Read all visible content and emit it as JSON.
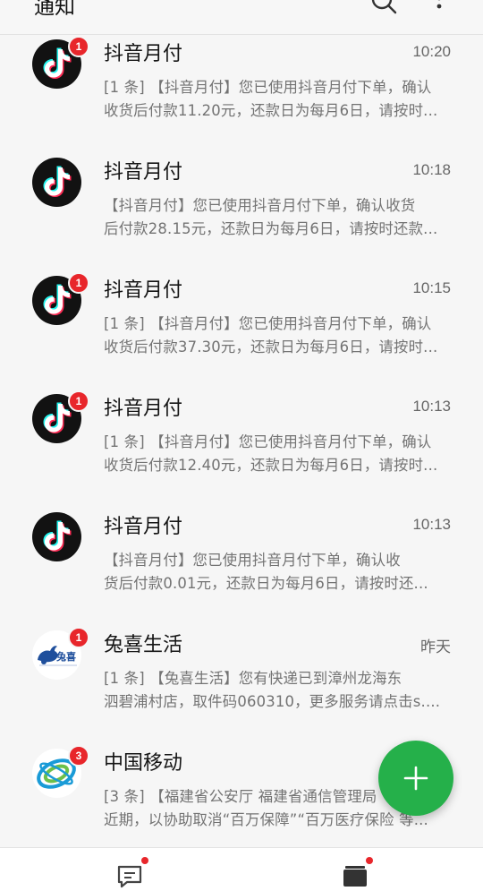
{
  "header": {
    "title": "通知"
  },
  "notifications": [
    {
      "name": "抖音月付",
      "time": "10:20",
      "badge": "1",
      "icon": "tiktok-icon",
      "line1": "[1 条] 【抖音月付】您已使用抖音月付下单，确认",
      "line2": "收货后付款11.20元，还款日为每月6日，请按时..."
    },
    {
      "name": "抖音月付",
      "time": "10:18",
      "badge": "",
      "icon": "tiktok-icon",
      "line1": "【抖音月付】您已使用抖音月付下单，确认收货",
      "line2": "后付款28.15元，还款日为每月6日，请按时还款..."
    },
    {
      "name": "抖音月付",
      "time": "10:15",
      "badge": "1",
      "icon": "tiktok-icon",
      "line1": "[1 条] 【抖音月付】您已使用抖音月付下单，确认",
      "line2": "收货后付款37.30元，还款日为每月6日，请按时..."
    },
    {
      "name": "抖音月付",
      "time": "10:13",
      "badge": "1",
      "icon": "tiktok-icon",
      "line1": "[1 条] 【抖音月付】您已使用抖音月付下单，确认",
      "line2": "收货后付款12.40元，还款日为每月6日，请按时..."
    },
    {
      "name": "抖音月付",
      "time": "10:13",
      "badge": "",
      "icon": "tiktok-icon",
      "line1": "【抖音月付】您已使用抖音月付下单，确认收",
      "line2": "货后付款0.01元，还款日为每月6日，请按时还..."
    },
    {
      "name": "兔喜生活",
      "time": "昨天",
      "badge": "1",
      "icon": "tuxi-logo-icon",
      "logo_text": "兔喜",
      "line1": "[1 条] 【兔喜生活】您有快递已到漳州龙海东",
      "line2": "泗碧浦村店，取件码060310，更多服务请点击s...."
    },
    {
      "name": "中国移动",
      "time": "",
      "badge": "3",
      "icon": "china-mobile-icon",
      "line1": "[3 条] 【福建省公安厅 福建省通信管理局",
      "line2": "近期，以协助取消“百万保障”“百万医疗保险 等..."
    }
  ],
  "colors": {
    "accent": "#25b04a",
    "badge": "#e8262b",
    "tiktok_cyan": "#25f4ee",
    "tiktok_red": "#fe2c55"
  }
}
